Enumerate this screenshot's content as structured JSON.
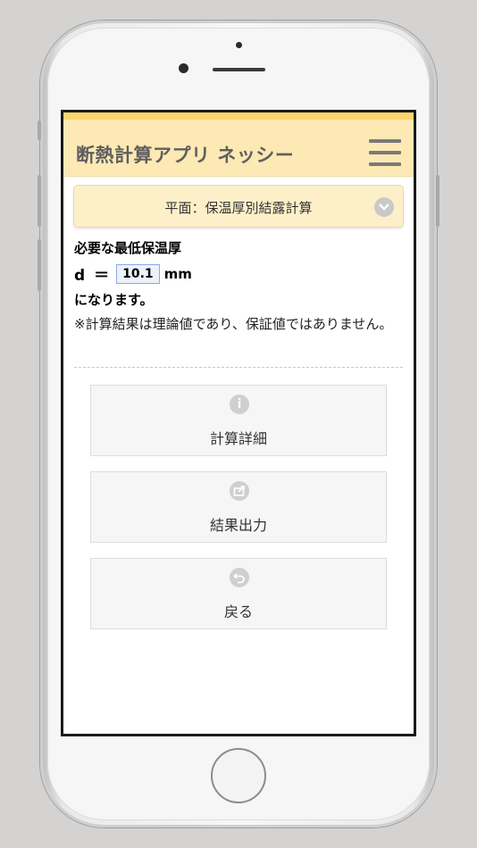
{
  "header": {
    "app_title": "断熱計算アプリ ネッシー"
  },
  "mode": {
    "label": "平面：保温厚別結露計算"
  },
  "result": {
    "line1": "必要な最低保温厚",
    "d_label": "d ＝",
    "value": "10.1",
    "unit": "mm",
    "line3": "になります。",
    "note": "※計算結果は理論値であり、保証値ではありません。"
  },
  "actions": [
    {
      "label": "計算詳細",
      "icon": "info-icon"
    },
    {
      "label": "結果出力",
      "icon": "export-icon"
    },
    {
      "label": "戻る",
      "icon": "back-icon"
    }
  ],
  "colors": {
    "background": "#d4d3d1",
    "header_bg": "#fde9b4",
    "header_accent": "#fbd56b",
    "mode_bar_bg": "#fdf0c9",
    "button_bg": "#f6f6f6"
  }
}
